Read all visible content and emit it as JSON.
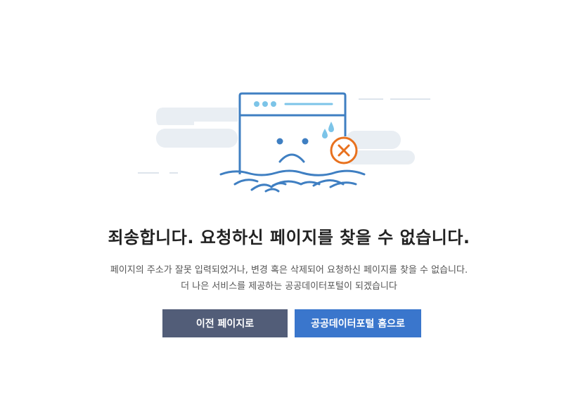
{
  "error": {
    "title": "죄송합니다. 요청하신 페이지를 찾을 수 없습니다.",
    "description_line1": "페이지의 주소가 잘못 입력되었거나, 변경 혹은 삭제되어 요청하신 페이지를 찾을 수 없습니다.",
    "description_line2": "더 나은 서비스를 제공하는 공공데이터포털이 되겠습니다"
  },
  "buttons": {
    "prev_label": "이전 페이지로",
    "home_label": "공공데이터포털 홈으로"
  },
  "colors": {
    "illustration_blue": "#3f7fc2",
    "accent_orange": "#e8711e",
    "cloud_gray": "#e9eef3",
    "prev_button": "#525d78",
    "home_button": "#3a76cc"
  },
  "icons": [
    "sad-browser-icon",
    "error-x-icon",
    "sweat-drop-icon",
    "cloud-decoration"
  ]
}
